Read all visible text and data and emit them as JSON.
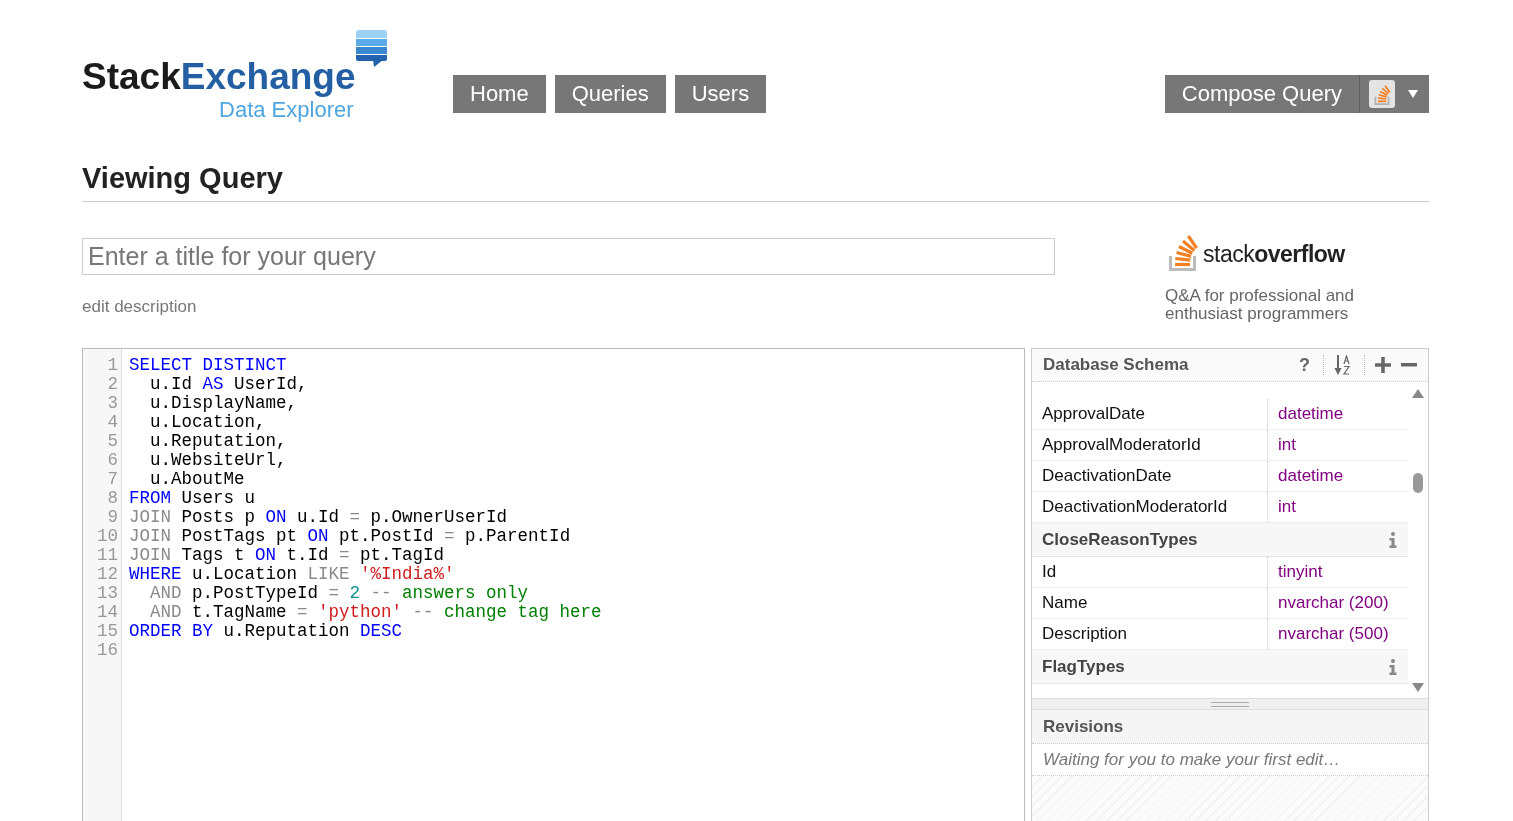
{
  "header": {
    "logo": {
      "wordmark": [
        "Stack",
        "Exchange"
      ],
      "subtitle": "Data Explorer"
    },
    "nav": [
      "Home",
      "Queries",
      "Users"
    ],
    "compose_button": "Compose Query"
  },
  "page_title": "Viewing Query",
  "title_field": {
    "placeholder": "Enter a title for your query"
  },
  "edit_description_link": "edit description",
  "site": {
    "wordmark": [
      "stack",
      "overflow"
    ],
    "tagline": "Q&A for professional and enthusiast programmers"
  },
  "editor": {
    "lines": [
      {
        "number": "1",
        "tokens": [
          {
            "kind": "keyword",
            "text": "SELECT DISTINCT"
          }
        ]
      },
      {
        "number": "2",
        "tokens": [
          {
            "kind": "plain",
            "text": "  u.Id "
          },
          {
            "kind": "keyword",
            "text": "AS"
          },
          {
            "kind": "plain",
            "text": " UserId,"
          }
        ]
      },
      {
        "number": "3",
        "tokens": [
          {
            "kind": "plain",
            "text": "  u.DisplayName,"
          }
        ]
      },
      {
        "number": "4",
        "tokens": [
          {
            "kind": "plain",
            "text": "  u.Location,"
          }
        ]
      },
      {
        "number": "5",
        "tokens": [
          {
            "kind": "plain",
            "text": "  u.Reputation,"
          }
        ]
      },
      {
        "number": "6",
        "tokens": [
          {
            "kind": "plain",
            "text": "  u.WebsiteUrl,"
          }
        ]
      },
      {
        "number": "7",
        "tokens": [
          {
            "kind": "plain",
            "text": "  u.AboutMe"
          }
        ]
      },
      {
        "number": "8",
        "tokens": [
          {
            "kind": "keyword",
            "text": "FROM"
          },
          {
            "kind": "plain",
            "text": " Users u"
          }
        ]
      },
      {
        "number": "9",
        "tokens": [
          {
            "kind": "operator",
            "text": "JOIN"
          },
          {
            "kind": "plain",
            "text": " Posts p "
          },
          {
            "kind": "keyword",
            "text": "ON"
          },
          {
            "kind": "plain",
            "text": " u.Id "
          },
          {
            "kind": "operator",
            "text": "="
          },
          {
            "kind": "plain",
            "text": " p.OwnerUserId"
          }
        ]
      },
      {
        "number": "10",
        "tokens": [
          {
            "kind": "operator",
            "text": "JOIN"
          },
          {
            "kind": "plain",
            "text": " PostTags pt "
          },
          {
            "kind": "keyword",
            "text": "ON"
          },
          {
            "kind": "plain",
            "text": " pt.PostId "
          },
          {
            "kind": "operator",
            "text": "="
          },
          {
            "kind": "plain",
            "text": " p.ParentId"
          }
        ]
      },
      {
        "number": "11",
        "tokens": [
          {
            "kind": "operator",
            "text": "JOIN"
          },
          {
            "kind": "plain",
            "text": " Tags t "
          },
          {
            "kind": "keyword",
            "text": "ON"
          },
          {
            "kind": "plain",
            "text": " t.Id "
          },
          {
            "kind": "operator",
            "text": "="
          },
          {
            "kind": "plain",
            "text": " pt.TagId"
          }
        ]
      },
      {
        "number": "12",
        "tokens": [
          {
            "kind": "keyword",
            "text": "WHERE"
          },
          {
            "kind": "plain",
            "text": " u.Location "
          },
          {
            "kind": "operator",
            "text": "LIKE"
          },
          {
            "kind": "string",
            "text": " '%India%'"
          }
        ]
      },
      {
        "number": "13",
        "tokens": [
          {
            "kind": "operator",
            "text": "  AND"
          },
          {
            "kind": "plain",
            "text": " p.PostTypeId "
          },
          {
            "kind": "operator",
            "text": "="
          },
          {
            "kind": "number",
            "text": " 2"
          },
          {
            "kind": "operator",
            "text": " --"
          },
          {
            "kind": "comment",
            "text": " answers only"
          }
        ]
      },
      {
        "number": "14",
        "tokens": [
          {
            "kind": "operator",
            "text": "  AND"
          },
          {
            "kind": "plain",
            "text": " t.TagName "
          },
          {
            "kind": "operator",
            "text": "="
          },
          {
            "kind": "string",
            "text": " 'python'"
          },
          {
            "kind": "operator",
            "text": " --"
          },
          {
            "kind": "comment",
            "text": " change tag here"
          }
        ]
      },
      {
        "number": "15",
        "tokens": [
          {
            "kind": "keyword",
            "text": "ORDER BY"
          },
          {
            "kind": "plain",
            "text": " u.Reputation "
          },
          {
            "kind": "keyword",
            "text": "DESC"
          }
        ]
      },
      {
        "number": "16"
      }
    ]
  },
  "schema": {
    "title": "Database Schema",
    "help": "?",
    "items": [
      {
        "kind": "column",
        "name": "ApprovalDate",
        "type": "datetime"
      },
      {
        "kind": "column",
        "name": "ApprovalModeratorId",
        "type": "int"
      },
      {
        "kind": "column",
        "name": "DeactivationDate",
        "type": "datetime"
      },
      {
        "kind": "column",
        "name": "DeactivationModeratorId",
        "type": "int"
      },
      {
        "kind": "table",
        "name": "CloseReasonTypes"
      },
      {
        "kind": "column",
        "name": "Id",
        "type": "tinyint"
      },
      {
        "kind": "column",
        "name": "Name",
        "type": "nvarchar (200)"
      },
      {
        "kind": "column",
        "name": "Description",
        "type": "nvarchar (500)"
      },
      {
        "kind": "table",
        "name": "FlagTypes"
      }
    ]
  },
  "revisions": {
    "title": "Revisions",
    "message": "Waiting for you to make your first edit…"
  }
}
